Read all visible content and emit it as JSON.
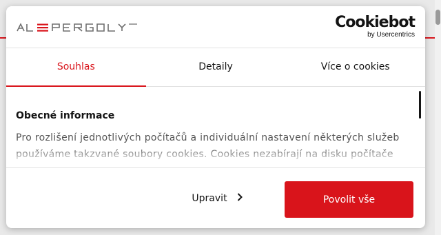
{
  "colors": {
    "accent": "#d9141b",
    "text": "#141414",
    "muted": "#555555"
  },
  "header": {
    "logo_alt": "ALUPERGOLY",
    "cookiebot_brand": "Cookiebot",
    "cookiebot_sub": "by Usercentrics"
  },
  "tabs": [
    {
      "label": "Souhlas",
      "active": true
    },
    {
      "label": "Detaily",
      "active": false
    },
    {
      "label": "Více o cookies",
      "active": false
    }
  ],
  "content": {
    "heading": "Obecné informace",
    "text": "Pro rozlišení jednotlivých počítačů a individuální nastavení některých služeb používáme takzvané soubory cookies. Cookies nezabírají na disku počítače"
  },
  "footer": {
    "customize_label": "Upravit",
    "allow_all_label": "Povolit vše"
  }
}
